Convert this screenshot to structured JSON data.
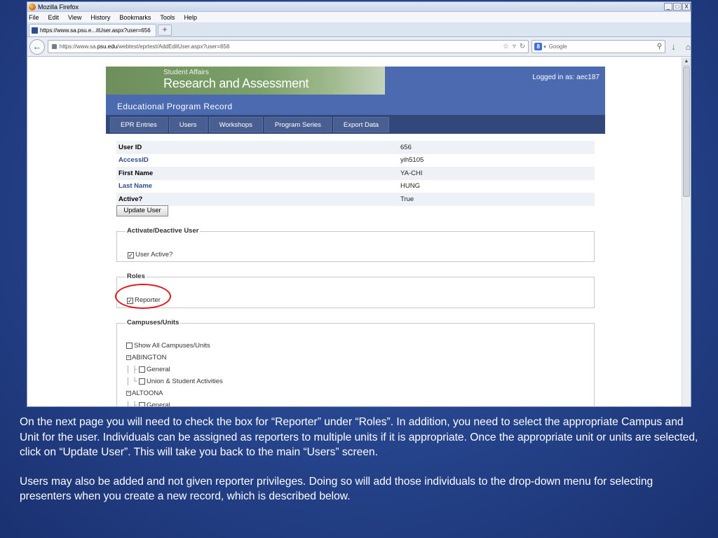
{
  "browser": {
    "window_title": "Mozilla Firefox",
    "window_buttons": [
      "_",
      "□",
      "X"
    ],
    "menu": [
      "File",
      "Edit",
      "View",
      "History",
      "Bookmarks",
      "Tools",
      "Help"
    ],
    "tab_title": "https://www.sa.psu.e...itUser.aspx?user=656",
    "new_tab": "+",
    "url_prefix": "https://www.sa.",
    "url_domain": "psu.edu",
    "url_rest": "/webtest/eprtest/AddEditUser.aspx?user=656",
    "search_placeholder": "Google",
    "search_engine_glyph": "8"
  },
  "site": {
    "banner_small": "Student Affairs",
    "banner_big": "Research and Assessment",
    "logged_in": "Logged in as: aec187",
    "record_title": "Educational Program Record",
    "nav": [
      "EPR Entries",
      "Users",
      "Workshops",
      "Program Series",
      "Export Data"
    ]
  },
  "user": {
    "rows": [
      {
        "label": "User ID",
        "value": "656"
      },
      {
        "label": "AccessID",
        "value": "yih5105"
      },
      {
        "label": "First Name",
        "value": "YA-CHI"
      },
      {
        "label": "Last Name",
        "value": "HUNG"
      },
      {
        "label": "Active?",
        "value": "True"
      }
    ],
    "update_button": "Update User"
  },
  "activate": {
    "legend": "Activate/Deactive User",
    "checkbox_label": "User Active?",
    "checked": true
  },
  "roles": {
    "legend": "Roles",
    "checkbox_label": "Reporter",
    "checked": true,
    "highlight_color": "#e0161b"
  },
  "campuses": {
    "legend": "Campuses/Units",
    "show_all_label": "Show All Campuses/Units",
    "tree": [
      {
        "type": "campus",
        "label": "ABINGTON"
      },
      {
        "type": "unit",
        "label": "General"
      },
      {
        "type": "unit",
        "label": "Union & Student Activities"
      },
      {
        "type": "campus",
        "label": "ALTOONA"
      },
      {
        "type": "unit",
        "label": "General"
      }
    ]
  },
  "caption": {
    "p1": "On the next page you will need to check the box  for “Reporter” under “Roles”. In addition, you need to select the appropriate Campus and Unit for the user. Individuals can be assigned as reporters to multiple units if it is appropriate. Once the appropriate unit or units are selected, click on “Update User”. This will take you back to the main “Users” screen.",
    "p2": "Users may also be added and not given reporter privileges. Doing so will add those individuals to the drop-down menu for selecting presenters when you create a new record, which is described below."
  },
  "colors": {
    "slide_background": "#27468f",
    "site_header": "#4b6ab0",
    "nav_bar": "#32477a"
  }
}
